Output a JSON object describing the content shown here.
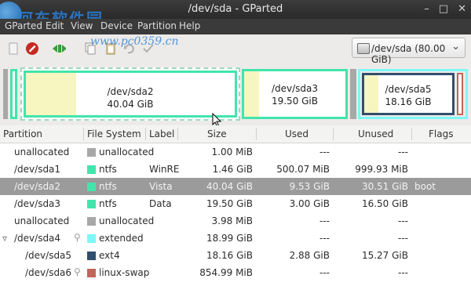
{
  "window": {
    "title": "/dev/sda - GParted",
    "controls": [
      "–",
      "□",
      "✕"
    ]
  },
  "watermark": {
    "text": "河东软件园",
    "url": "www.pc0359.cn"
  },
  "menu": [
    "GParted",
    "Edit",
    "View",
    "Device",
    "Partition",
    "Help"
  ],
  "device_selector": {
    "value": "/dev/sda  (80.00 GiB)"
  },
  "map": [
    {
      "name": "/dev/sda2",
      "size": "40.04 GiB",
      "used_fraction": 0.24
    },
    {
      "name": "/dev/sda3",
      "size": "19.50 GiB",
      "used_fraction": 0.15
    },
    {
      "name": "/dev/sda5",
      "size": "18.16 GiB",
      "used_fraction": 0.16
    }
  ],
  "columns": [
    "Partition",
    "File System",
    "Label",
    "Size",
    "Used",
    "Unused",
    "Flags"
  ],
  "rows": [
    {
      "partition": "unallocated",
      "fs": "unallocated",
      "color": "#a8a8a8",
      "label": "",
      "size": "1.00 MiB",
      "used": "---",
      "unused": "---",
      "flags": ""
    },
    {
      "partition": "/dev/sda1",
      "fs": "ntfs",
      "color": "#42e5ac",
      "label": "WinRE",
      "size": "1.46 GiB",
      "used": "500.07 MiB",
      "unused": "999.93 MiB",
      "flags": ""
    },
    {
      "partition": "/dev/sda2",
      "fs": "ntfs",
      "color": "#42e5ac",
      "label": "Vista",
      "size": "40.04 GiB",
      "used": "9.53 GiB",
      "unused": "30.51 GiB",
      "flags": "boot"
    },
    {
      "partition": "/dev/sda3",
      "fs": "ntfs",
      "color": "#42e5ac",
      "label": "Data",
      "size": "19.50 GiB",
      "used": "3.00 GiB",
      "unused": "16.50 GiB",
      "flags": ""
    },
    {
      "partition": "unallocated",
      "fs": "unallocated",
      "color": "#a8a8a8",
      "label": "",
      "size": "3.98 MiB",
      "used": "---",
      "unused": "---",
      "flags": ""
    },
    {
      "partition": "/dev/sda4",
      "fs": "extended",
      "color": "#7df7f7",
      "label": "",
      "size": "18.99 GiB",
      "used": "---",
      "unused": "---",
      "flags": ""
    },
    {
      "partition": "/dev/sda5",
      "fs": "ext4",
      "color": "#314e6c",
      "label": "",
      "size": "18.16 GiB",
      "used": "2.88 GiB",
      "unused": "15.27 GiB",
      "flags": ""
    },
    {
      "partition": "/dev/sda6",
      "fs": "linux-swap",
      "color": "#c1665a",
      "label": "",
      "size": "854.99 MiB",
      "used": "---",
      "unused": "---",
      "flags": ""
    }
  ]
}
